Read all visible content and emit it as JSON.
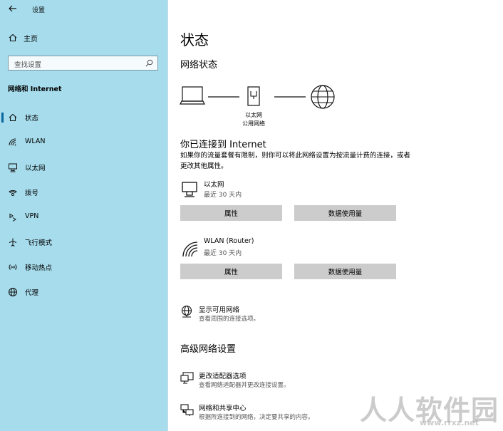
{
  "window": {
    "title": "设置"
  },
  "sidebar": {
    "home_label": "主页",
    "search_placeholder": "查找设置",
    "section_title": "网络和 Internet",
    "items": [
      {
        "label": "状态",
        "icon": "home-status-icon",
        "active": true
      },
      {
        "label": "WLAN",
        "icon": "wifi-icon",
        "active": false
      },
      {
        "label": "以太网",
        "icon": "ethernet-icon",
        "active": false
      },
      {
        "label": "拨号",
        "icon": "dialup-icon",
        "active": false
      },
      {
        "label": "VPN",
        "icon": "vpn-icon",
        "active": false
      },
      {
        "label": "飞行模式",
        "icon": "airplane-icon",
        "active": false
      },
      {
        "label": "移动热点",
        "icon": "hotspot-icon",
        "active": false
      },
      {
        "label": "代理",
        "icon": "globe-icon",
        "active": false
      }
    ]
  },
  "main": {
    "title": "状态",
    "network_status_heading": "网络状态",
    "diagram": {
      "label_1": "以太网",
      "label_2": "公用网络"
    },
    "connected_heading": "你已连接到 Internet",
    "description": "如果你的流量套餐有限制，则你可以将此网络设置为按流量计费的连接，或者更改其他属性。",
    "connections": [
      {
        "name": "以太网",
        "sub": "最近 30 天内",
        "btn_properties": "属性",
        "btn_data": "数据使用量",
        "icon": "ethernet-icon"
      },
      {
        "name": "WLAN (Router)",
        "sub": "最近 30 天内",
        "btn_properties": "属性",
        "btn_data": "数据使用量",
        "icon": "wifi-icon"
      }
    ],
    "show_networks": {
      "title": "显示可用网络",
      "sub": "查看周围的连接选项。"
    },
    "advanced_heading": "高级网络设置",
    "advanced": [
      {
        "title": "更改适配器选项",
        "sub": "查看网络适配器并更改连接设置。"
      },
      {
        "title": "网络和共享中心",
        "sub": "根据所连接到的网络，决定要共享的内容。"
      }
    ]
  },
  "watermark": {
    "big": "人人软件园",
    "small": "www.rrxz.net"
  },
  "colors": {
    "sidebar_bg": "#a6dcec",
    "main_bg": "#ffffff",
    "button_bg": "#cccccc",
    "accent": "#0a64a0"
  }
}
